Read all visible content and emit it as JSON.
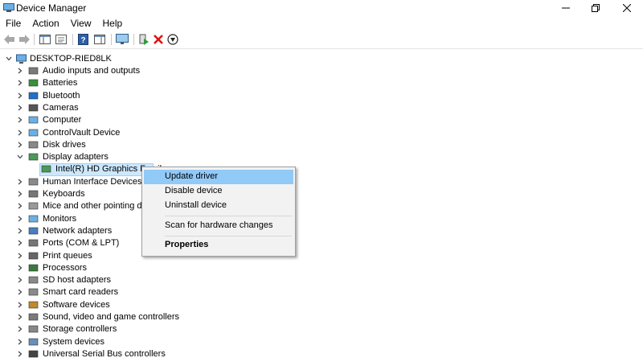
{
  "window": {
    "title": "Device Manager"
  },
  "menu": [
    "File",
    "Action",
    "View",
    "Help"
  ],
  "toolbar": {
    "buttons": [
      "back-icon",
      "forward-icon",
      "show-hide-tree-icon",
      "properties-icon",
      "help-icon",
      "action-pane-icon",
      "monitor-icon",
      "update-driver-icon",
      "uninstall-icon",
      "disable-icon"
    ]
  },
  "tree": {
    "root": "DESKTOP-RIED8LK",
    "categories": [
      {
        "label": "Audio inputs and outputs",
        "icon": "speaker-icon"
      },
      {
        "label": "Batteries",
        "icon": "battery-icon"
      },
      {
        "label": "Bluetooth",
        "icon": "bluetooth-icon"
      },
      {
        "label": "Cameras",
        "icon": "camera-icon"
      },
      {
        "label": "Computer",
        "icon": "computer-icon"
      },
      {
        "label": "ControlVault Device",
        "icon": "controlvault-icon"
      },
      {
        "label": "Disk drives",
        "icon": "disk-icon"
      },
      {
        "label": "Display adapters",
        "icon": "display-adapter-icon",
        "expanded": true
      },
      {
        "label": "Intel(R) HD Graphics Famil",
        "icon": "display-adapter-icon",
        "child": true
      },
      {
        "label": "Human Interface Devices",
        "icon": "hid-icon"
      },
      {
        "label": "Keyboards",
        "icon": "keyboard-icon"
      },
      {
        "label": "Mice and other pointing dev",
        "icon": "mouse-icon"
      },
      {
        "label": "Monitors",
        "icon": "monitor-icon"
      },
      {
        "label": "Network adapters",
        "icon": "network-icon"
      },
      {
        "label": "Ports (COM & LPT)",
        "icon": "port-icon"
      },
      {
        "label": "Print queues",
        "icon": "printer-icon"
      },
      {
        "label": "Processors",
        "icon": "processor-icon"
      },
      {
        "label": "SD host adapters",
        "icon": "sd-icon"
      },
      {
        "label": "Smart card readers",
        "icon": "smartcard-icon"
      },
      {
        "label": "Software devices",
        "icon": "software-icon"
      },
      {
        "label": "Sound, video and game controllers",
        "icon": "sound-icon"
      },
      {
        "label": "Storage controllers",
        "icon": "storage-icon"
      },
      {
        "label": "System devices",
        "icon": "system-icon"
      },
      {
        "label": "Universal Serial Bus controllers",
        "icon": "usb-icon"
      }
    ]
  },
  "context_menu": {
    "items": [
      "Update driver",
      "Disable device",
      "Uninstall device",
      "Scan for hardware changes",
      "Properties"
    ]
  }
}
